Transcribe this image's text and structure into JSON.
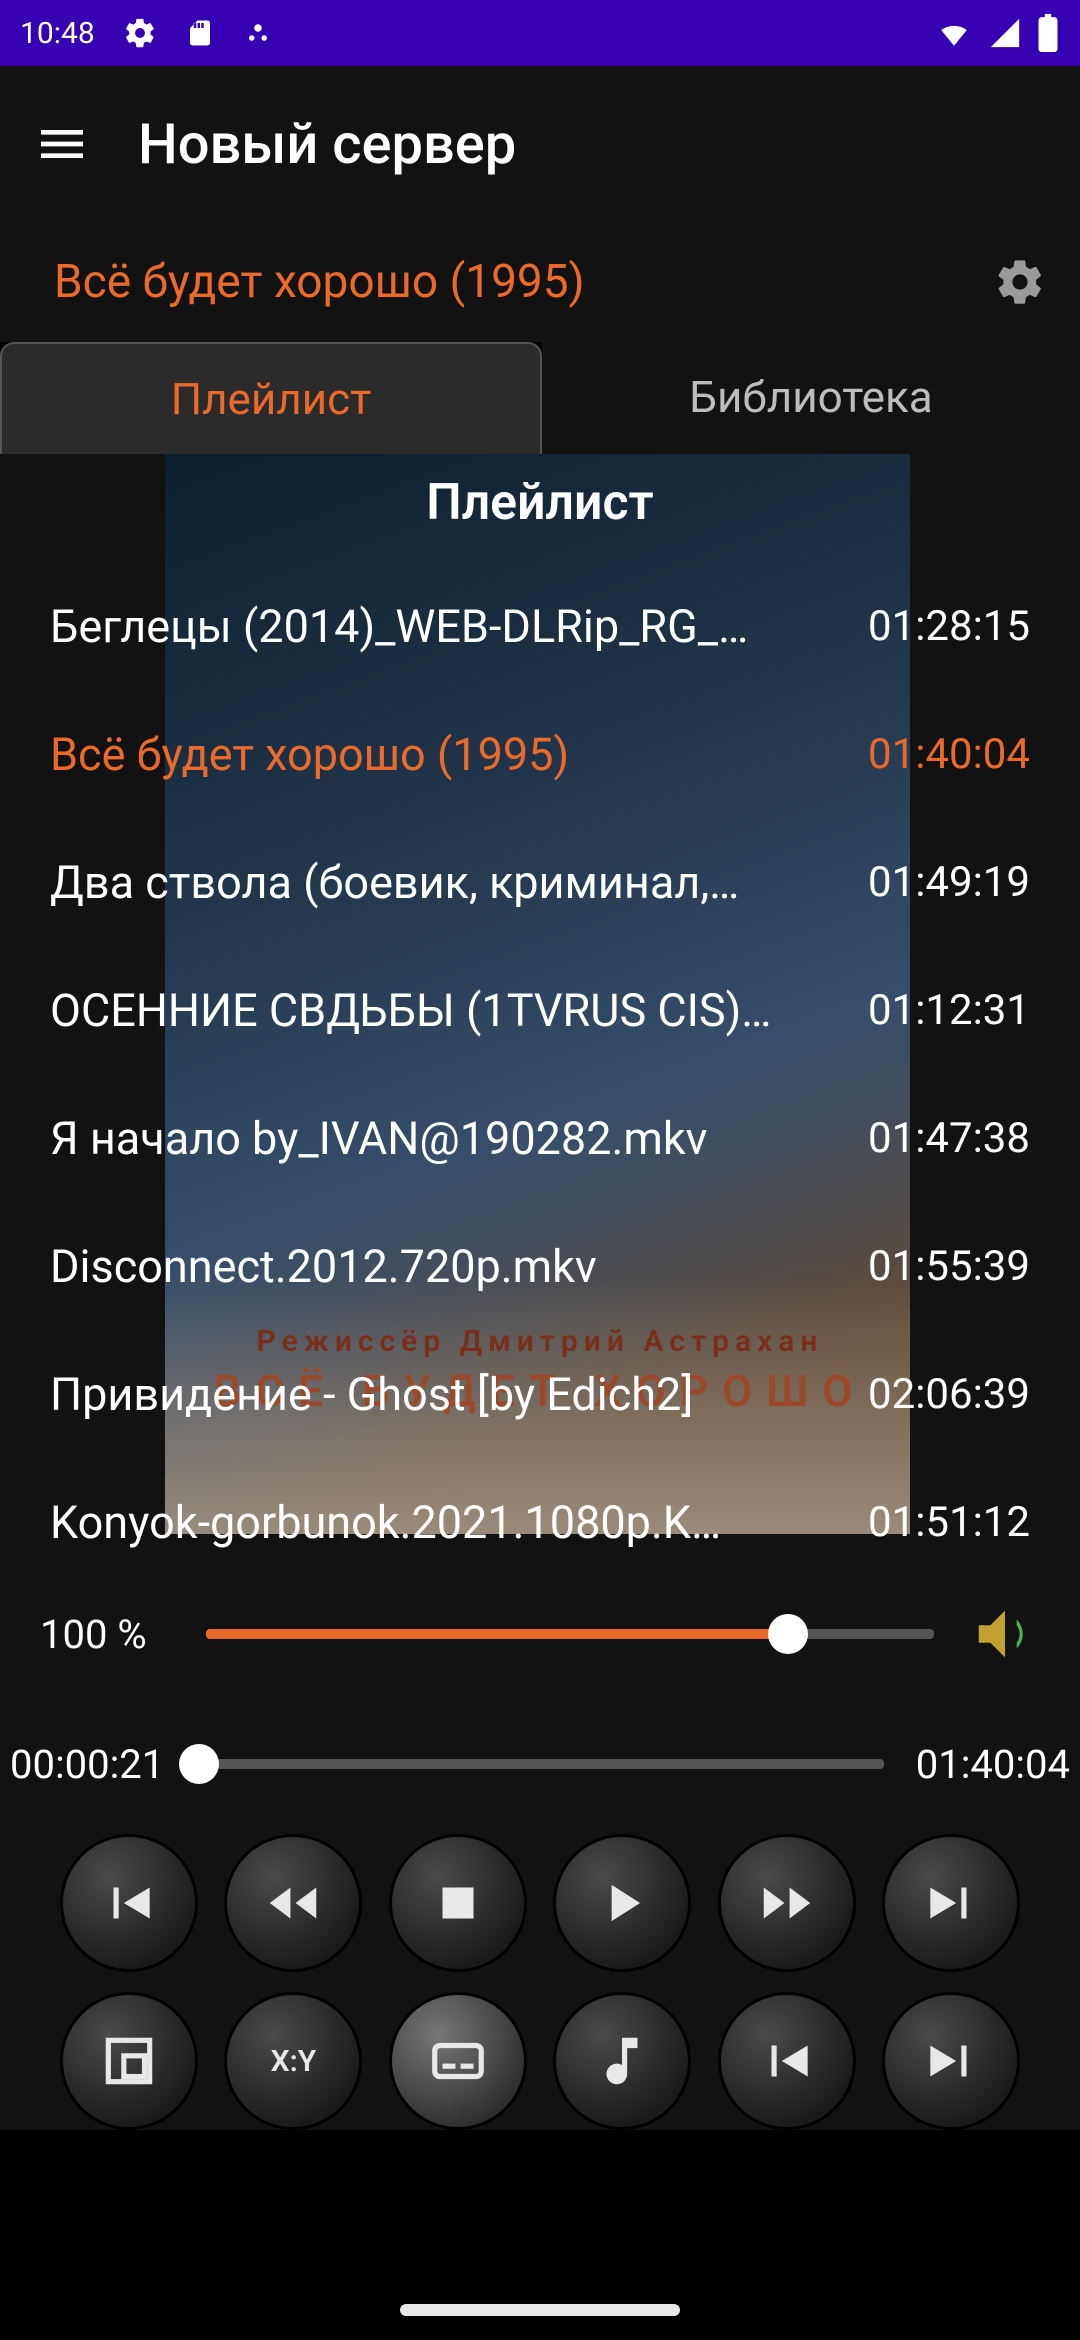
{
  "status": {
    "time": "10:48"
  },
  "header": {
    "title": "Новый сервер"
  },
  "now_playing": {
    "title": "Всё будет хорошо (1995)"
  },
  "tabs": [
    {
      "label": "Плейлист",
      "active": true
    },
    {
      "label": "Библиотека",
      "active": false
    }
  ],
  "playlist": {
    "header": "Плейлист",
    "items": [
      {
        "name": "Беглецы (2014)_WEB-DLRip_RG_…",
        "duration": "01:28:15",
        "active": false
      },
      {
        "name": "Всё будет хорошо (1995)",
        "duration": "01:40:04",
        "active": true
      },
      {
        "name": "Два ствола  (боевик, криминал,…",
        "duration": "01:49:19",
        "active": false
      },
      {
        "name": "ОСЕННИЕ СВДЬБЫ (1TVRUS CIS)…",
        "duration": "01:12:31",
        "active": false
      },
      {
        "name": "Я начало by_IVAN@190282.mkv",
        "duration": "01:47:38",
        "active": false
      },
      {
        "name": "Disconnect.2012.720p.mkv",
        "duration": "01:55:39",
        "active": false
      },
      {
        "name": "Привидение - Ghost [by Edich2]",
        "duration": "02:06:39",
        "active": false
      },
      {
        "name": "Konyok-gorbunok.2021.1080p.K…",
        "duration": "01:51:12",
        "active": false
      }
    ]
  },
  "volume": {
    "label": "100 %",
    "percent": 80
  },
  "progress": {
    "elapsed": "00:00:21",
    "total": "01:40:04",
    "percent": 0.35
  },
  "poster": {
    "line1": "Режиссёр   Дмитрий Астрахан",
    "line2": "ВСЁ  БУДЕТ  ХОРОШО"
  },
  "controls_row2": {
    "aspect_label": "X:Y"
  },
  "colors": {
    "accent": "#ea6a2c",
    "statusbar": "#3700B3"
  }
}
